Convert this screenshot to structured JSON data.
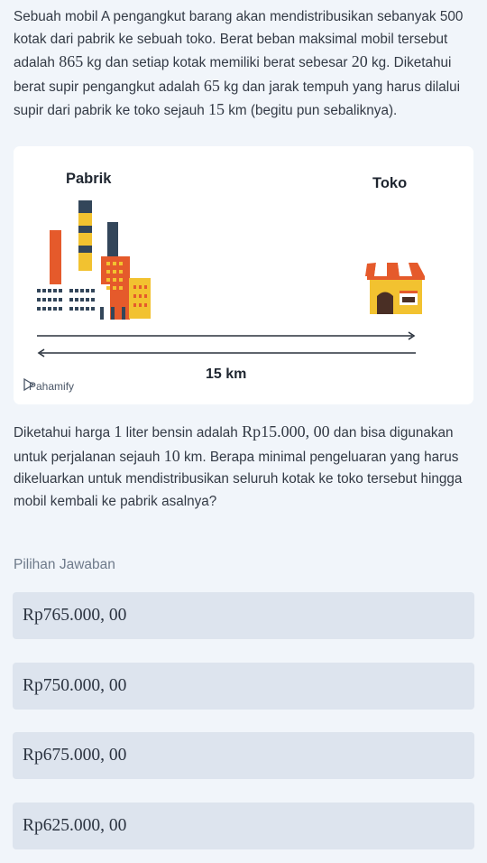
{
  "question": {
    "part1": [
      {
        "t": "Sebuah mobil A pengangkut barang akan mendistribusikan sebanyak 500 kotak dari pabrik ke sebuah toko. Berat beban maksimal mobil tersebut adalah "
      },
      {
        "m": "865"
      },
      {
        "t": " kg dan setiap kotak memiliki berat sebesar "
      },
      {
        "m": "20"
      },
      {
        "t": " kg. Diketahui berat supir pengangkut adalah "
      },
      {
        "m": "65"
      },
      {
        "t": " kg dan jarak tempuh yang harus dilalui supir dari pabrik ke toko sejauh "
      },
      {
        "m": "15"
      },
      {
        "t": " km (begitu pun sebaliknya)."
      }
    ],
    "part2": [
      {
        "t": "Diketahui harga "
      },
      {
        "m": "1"
      },
      {
        "t": " liter bensin adalah "
      },
      {
        "m": "Rp15.000, 00"
      },
      {
        "t": " dan bisa digunakan untuk perjalanan sejauh "
      },
      {
        "m": "10"
      },
      {
        "t": " km. Berapa minimal pengeluaran yang harus dikeluarkan untuk mendistribusikan seluruh kotak ke toko tersebut hingga mobil kembali ke pabrik asalnya?"
      }
    ]
  },
  "illustration": {
    "factory_label": "Pabrik",
    "shop_label": "Toko",
    "distance_label": "15 km",
    "logo_text": "Pahamify"
  },
  "choices": {
    "title": "Pilihan Jawaban",
    "options": [
      "Rp765.000, 00",
      "Rp750.000, 00",
      "Rp675.000, 00",
      "Rp625.000, 00"
    ]
  }
}
